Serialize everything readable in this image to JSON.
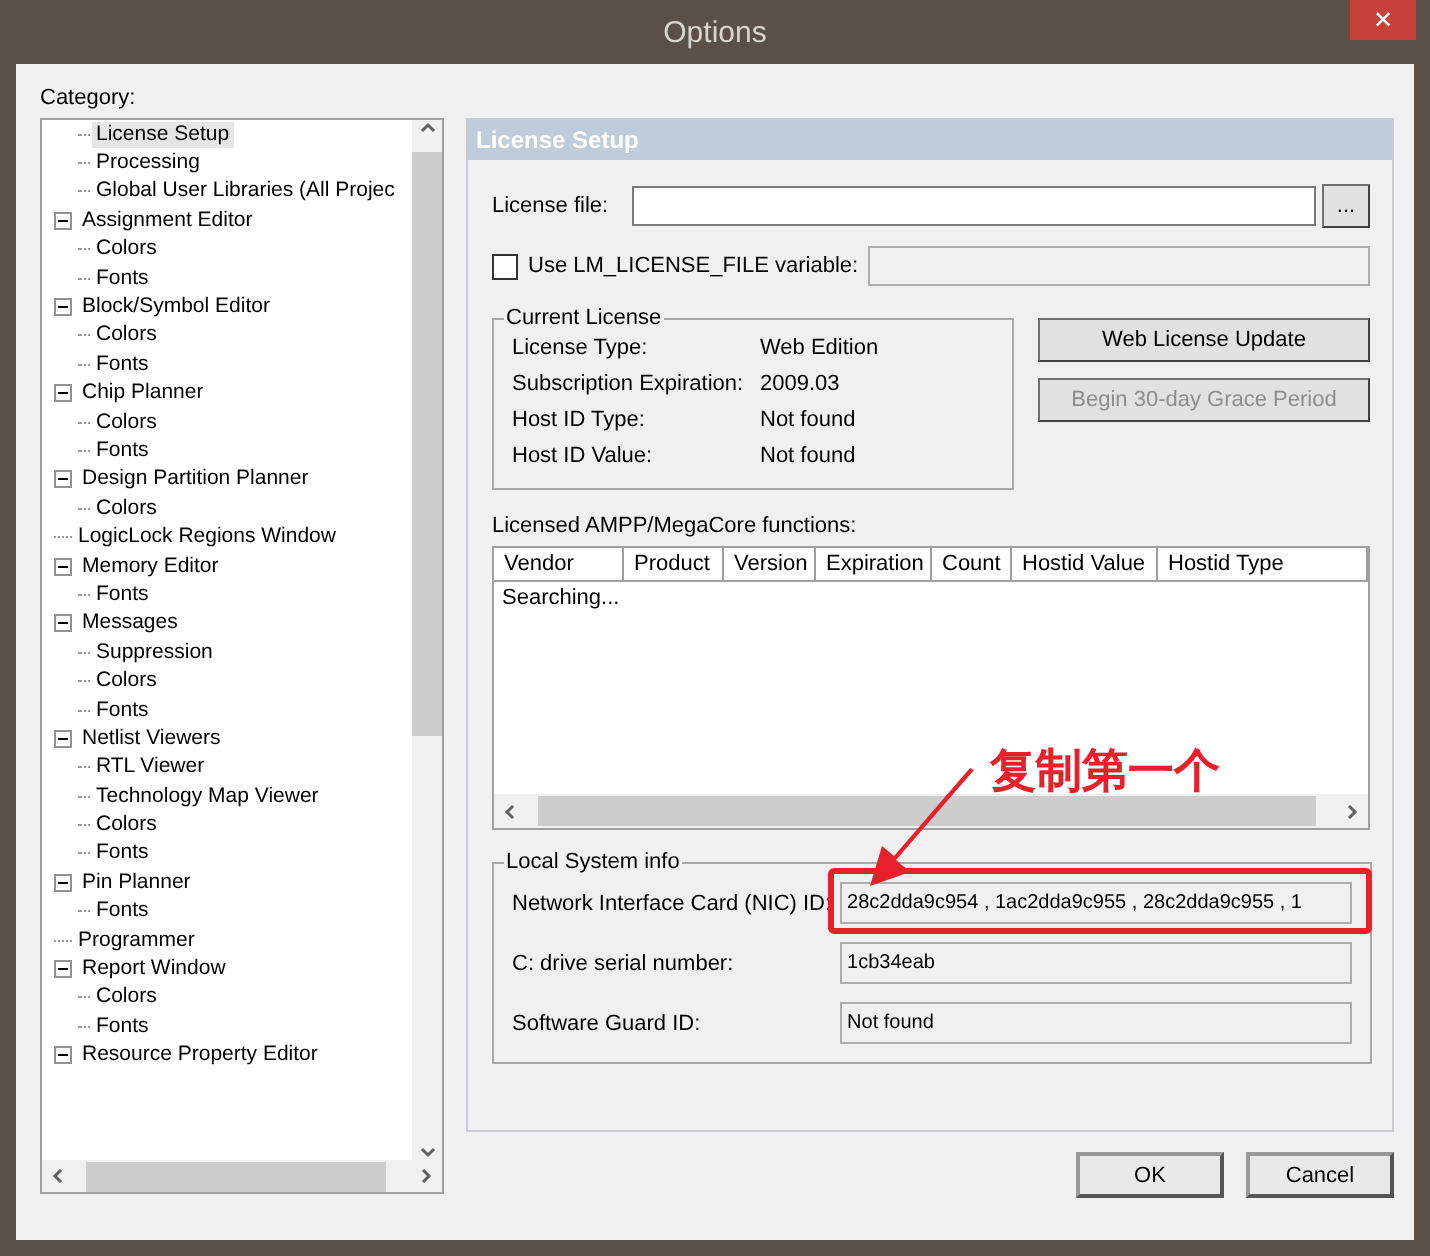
{
  "window": {
    "title": "Options",
    "close_label": "✕"
  },
  "category": {
    "label": "Category:",
    "continued_children": [
      {
        "label": "License Setup",
        "selected": true
      },
      {
        "label": "Processing",
        "selected": false
      },
      {
        "label": "Global User Libraries (All Projec",
        "selected": false
      }
    ],
    "items": [
      {
        "label": "Assignment Editor",
        "selected": false,
        "expanded": true,
        "children": [
          {
            "label": "Colors",
            "selected": false
          },
          {
            "label": "Fonts",
            "selected": false
          }
        ]
      },
      {
        "label": "Block/Symbol Editor",
        "selected": false,
        "expanded": true,
        "children": [
          {
            "label": "Colors",
            "selected": false
          },
          {
            "label": "Fonts",
            "selected": false
          }
        ]
      },
      {
        "label": "Chip Planner",
        "selected": false,
        "expanded": true,
        "children": [
          {
            "label": "Colors",
            "selected": false
          },
          {
            "label": "Fonts",
            "selected": false
          }
        ]
      },
      {
        "label": "Design Partition Planner",
        "selected": false,
        "expanded": true,
        "children": [
          {
            "label": "Colors",
            "selected": false
          }
        ]
      },
      {
        "label": "LogicLock Regions Window",
        "selected": false
      },
      {
        "label": "Memory Editor",
        "selected": false,
        "expanded": true,
        "children": [
          {
            "label": "Fonts",
            "selected": false
          }
        ]
      },
      {
        "label": "Messages",
        "selected": false,
        "expanded": true,
        "children": [
          {
            "label": "Suppression",
            "selected": false
          },
          {
            "label": "Colors",
            "selected": false
          },
          {
            "label": "Fonts",
            "selected": false
          }
        ]
      },
      {
        "label": "Netlist Viewers",
        "selected": false,
        "expanded": true,
        "children": [
          {
            "label": "RTL Viewer",
            "selected": false
          },
          {
            "label": "Technology Map Viewer",
            "selected": false
          },
          {
            "label": "Colors",
            "selected": false
          },
          {
            "label": "Fonts",
            "selected": false
          }
        ]
      },
      {
        "label": "Pin Planner",
        "selected": false,
        "expanded": true,
        "children": [
          {
            "label": "Fonts",
            "selected": false
          }
        ]
      },
      {
        "label": "Programmer",
        "selected": false
      },
      {
        "label": "Report Window",
        "selected": false,
        "expanded": true,
        "children": [
          {
            "label": "Colors",
            "selected": false
          },
          {
            "label": "Fonts",
            "selected": false
          }
        ]
      },
      {
        "label": "Resource Property Editor",
        "selected": false,
        "expanded": true
      }
    ]
  },
  "panel": {
    "title": "License Setup",
    "license_file": {
      "label": "License file:",
      "browse_label": "..."
    },
    "use_lm_license": {
      "label": "Use LM_LICENSE_FILE variable:",
      "checked": false
    },
    "current_license": {
      "title": "Current License",
      "rows": [
        {
          "label": "License Type:",
          "value": "Web Edition"
        },
        {
          "label": "Subscription Expiration:",
          "value": "2009.03"
        },
        {
          "label": "Host ID Type:",
          "value": "Not found"
        },
        {
          "label": "Host ID Value:",
          "value": "Not found"
        }
      ]
    },
    "buttons": [
      {
        "label": "Web License Update",
        "disabled": false
      },
      {
        "label": "Begin 30-day Grace Period",
        "disabled": true
      }
    ],
    "functions": {
      "label": "Licensed AMPP/MegaCore functions:",
      "columns": [
        "Vendor",
        "Product",
        "Version",
        "Expiration",
        "Count",
        "Hostid Value",
        "Hostid Type"
      ],
      "status": "Searching..."
    },
    "local_system": {
      "title": "Local System info",
      "rows": [
        {
          "label": "Network Interface Card (NIC) ID:",
          "value": "28c2dda9c954 , 1ac2dda9c955 , 28c2dda9c955 , 1",
          "highlighted": true
        },
        {
          "label": "C: drive serial number:",
          "value": "1cb34eab",
          "highlighted": false
        },
        {
          "label": "Software Guard ID:",
          "value": "Not found",
          "highlighted": false
        }
      ]
    }
  },
  "annotation": {
    "text": "复制第一个"
  },
  "footer": {
    "buttons": [
      "OK",
      "Cancel"
    ]
  }
}
